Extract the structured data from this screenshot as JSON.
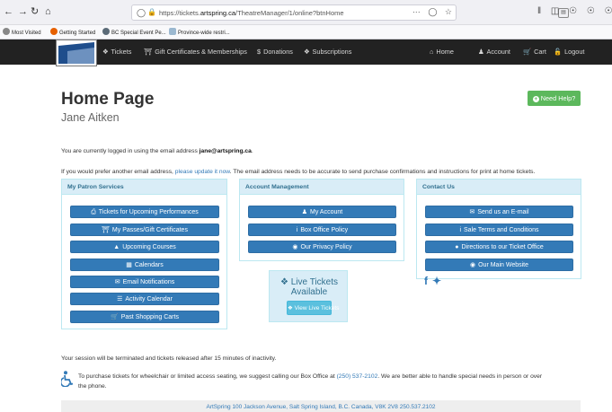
{
  "browser": {
    "url_prefix": "https://tickets.",
    "url_host": "artspring.ca",
    "url_path": "/TheatreManager/1/online?btnHome",
    "more_label": "···"
  },
  "bookmarks": [
    {
      "label": "Most Visited",
      "color": "#888888"
    },
    {
      "label": "Getting Started",
      "color": "#e66000"
    },
    {
      "label": "BC Special Event Pe...",
      "color": "#5b6b78"
    },
    {
      "label": "Province-wide restri...",
      "color": "#9bb8d0"
    }
  ],
  "nav": {
    "tickets": "Tickets",
    "gift": "Gift Certificates & Memberships",
    "donations": "Donations",
    "subscriptions": "Subscriptions",
    "home": "Home",
    "account": "Account",
    "cart": "Cart",
    "logout": "Logout"
  },
  "header": {
    "title": "Home Page",
    "name": "Jane Aitken",
    "help": "Need Help?"
  },
  "info": {
    "logged_in_prefix": "You are currently logged in using the email address ",
    "email": "jane@artspring.ca",
    "logged_in_suffix": ".",
    "update_prefix": "If you would prefer another email address, ",
    "update_link": "please update it now",
    "update_suffix": ". The email address needs to be accurate to send purchase confirmations and instructions for print at home tickets."
  },
  "patron_services": {
    "title": "My Patron Services",
    "buttons": [
      "Tickets for Upcoming Performances",
      "My Passes/Gift Certificates",
      "Upcoming Courses",
      "Calendars",
      "Email Notifications",
      "Activity Calendar",
      "Past Shopping Carts"
    ]
  },
  "account_mgmt": {
    "title": "Account Management",
    "buttons": [
      "My Account",
      "Box Office Policy",
      "Our Privacy Policy"
    ]
  },
  "contact": {
    "title": "Contact Us",
    "buttons": [
      "Send us an E-mail",
      "Sale Terms and Conditions",
      "Directions to our Ticket Office",
      "Our Main Website"
    ]
  },
  "live": {
    "title_line1": "Live Tickets",
    "title_line2": "Available",
    "button": "View Live Tickets"
  },
  "session_note": "Your session will be terminated and tickets released after 15 minutes of inactivity.",
  "accessibility": {
    "prefix": "To purchase tickets for wheelchair or limited access seating, we suggest calling our Box Office at ",
    "phone": "(250) 537-2102",
    "suffix": ". We are better able to handle special needs in person or over",
    "line2": "the phone."
  },
  "footer": "ArtSpring 100 Jackson Avenue, Salt Spring Island, B.C. Canada, V8K 2V8 250.537.2102",
  "colors": {
    "primary": "#337ab7",
    "success": "#5cb85c",
    "info_bg": "#d9edf7",
    "nav_bg": "#222222"
  }
}
